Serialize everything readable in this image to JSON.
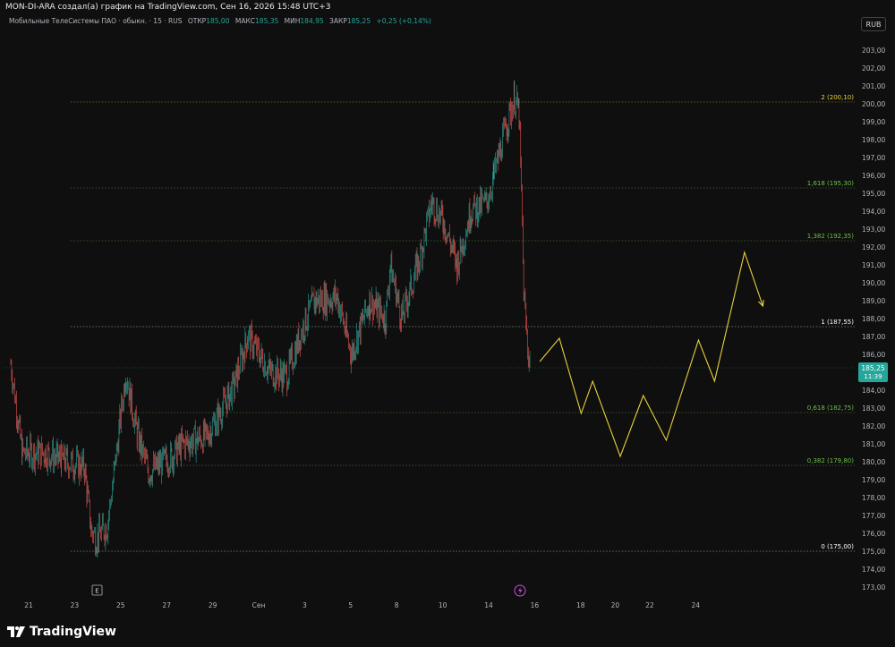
{
  "header": {
    "caption": "MON-DI-ARA создал(а) график на TradingView.com, Сен 16, 2026 15:48 UTC+3"
  },
  "legend": {
    "symbol": "Мобильные ТелеСистемы ПАО · обыкн. · 15 · RUS",
    "open_label": "ОТКР",
    "open": "185,00",
    "high_label": "МАКС",
    "high": "185,35",
    "low_label": "МИН",
    "low": "184,95",
    "close_label": "ЗАКР",
    "close": "185,25",
    "change": "+0,25 (+0,14%)"
  },
  "currency_button": "RUB",
  "event_marker": "E",
  "logo_text": "TradingView",
  "colors": {
    "background": "#0f0f0f",
    "up": "#26a69a",
    "down": "#ef5350",
    "projection": "#e8d13c",
    "fib_green": "#6cc04a",
    "fib_yellow": "#e8d13c",
    "fib_white": "#ffffff"
  },
  "chart_data": {
    "type": "line",
    "y_axis": {
      "ylim": [
        172.6,
        203.8
      ],
      "ticks": [
        "173,00",
        "174,00",
        "175,00",
        "176,00",
        "177,00",
        "178,00",
        "179,00",
        "180,00",
        "181,00",
        "182,00",
        "183,00",
        "184,00",
        "185,00",
        "186,00",
        "187,00",
        "188,00",
        "189,00",
        "190,00",
        "191,00",
        "192,00",
        "193,00",
        "194,00",
        "195,00",
        "196,00",
        "197,00",
        "198,00",
        "199,00",
        "200,00",
        "201,00",
        "202,00",
        "203,00"
      ],
      "tick_values": [
        173,
        174,
        175,
        176,
        177,
        178,
        179,
        180,
        181,
        182,
        183,
        184,
        185,
        186,
        187,
        188,
        189,
        190,
        191,
        192,
        193,
        194,
        195,
        196,
        197,
        198,
        199,
        200,
        201,
        202,
        203
      ]
    },
    "x_axis": {
      "labels": [
        "21",
        "23",
        "25",
        "27",
        "29",
        "Сен",
        "3",
        "5",
        "8",
        "10",
        "14",
        "16",
        "18",
        "20",
        "22",
        "24"
      ],
      "positions": [
        0,
        2,
        4,
        6,
        8,
        10,
        12,
        14,
        16,
        18,
        20,
        22,
        24,
        25.5,
        27,
        29
      ]
    },
    "last_price": {
      "value": 185.25,
      "label": "185,25",
      "time": "11:39"
    },
    "price_path": [
      {
        "x": 0,
        "y": 185.5
      },
      {
        "x": 0.5,
        "y": 180.5
      },
      {
        "x": 1.5,
        "y": 180.5
      },
      {
        "x": 2.2,
        "y": 180.1
      },
      {
        "x": 3.2,
        "y": 179.7
      },
      {
        "x": 3.5,
        "y": 176.2
      },
      {
        "x": 3.7,
        "y": 175.7
      },
      {
        "x": 4.2,
        "y": 176.4
      },
      {
        "x": 4.6,
        "y": 180.5
      },
      {
        "x": 5.0,
        "y": 185.0
      },
      {
        "x": 5.5,
        "y": 181.5
      },
      {
        "x": 6.0,
        "y": 179.4
      },
      {
        "x": 7.0,
        "y": 180.3
      },
      {
        "x": 7.5,
        "y": 181.0
      },
      {
        "x": 8.5,
        "y": 181.4
      },
      {
        "x": 9.0,
        "y": 182.5
      },
      {
        "x": 9.7,
        "y": 184.2
      },
      {
        "x": 10.3,
        "y": 187.0
      },
      {
        "x": 11.3,
        "y": 185.0
      },
      {
        "x": 12.0,
        "y": 184.8
      },
      {
        "x": 12.7,
        "y": 187.5
      },
      {
        "x": 13.2,
        "y": 189.0
      },
      {
        "x": 14.2,
        "y": 189.2
      },
      {
        "x": 14.8,
        "y": 186.0
      },
      {
        "x": 15.6,
        "y": 189.0
      },
      {
        "x": 16.3,
        "y": 188.0
      },
      {
        "x": 16.5,
        "y": 191.0
      },
      {
        "x": 17.0,
        "y": 188.0
      },
      {
        "x": 17.8,
        "y": 191.5
      },
      {
        "x": 18.3,
        "y": 194.5
      },
      {
        "x": 18.8,
        "y": 193.5
      },
      {
        "x": 19.4,
        "y": 191.0
      },
      {
        "x": 20.0,
        "y": 194.0
      },
      {
        "x": 20.7,
        "y": 194.5
      },
      {
        "x": 21.0,
        "y": 196.0
      },
      {
        "x": 21.6,
        "y": 199.0
      },
      {
        "x": 21.9,
        "y": 200.3
      },
      {
        "x": 22.1,
        "y": 199.5
      },
      {
        "x": 22.2,
        "y": 195.0
      },
      {
        "x": 22.3,
        "y": 189.5
      },
      {
        "x": 22.5,
        "y": 186.0
      },
      {
        "x": 22.6,
        "y": 185.25
      }
    ],
    "projection": [
      {
        "x": 23.0,
        "y": 185.6
      },
      {
        "x": 23.85,
        "y": 186.9
      },
      {
        "x": 24.8,
        "y": 182.7
      },
      {
        "x": 25.3,
        "y": 184.5
      },
      {
        "x": 26.5,
        "y": 180.3
      },
      {
        "x": 27.5,
        "y": 183.7
      },
      {
        "x": 28.5,
        "y": 181.2
      },
      {
        "x": 29.9,
        "y": 186.8
      },
      {
        "x": 30.6,
        "y": 184.5
      },
      {
        "x": 31.9,
        "y": 191.7
      },
      {
        "x": 32.7,
        "y": 188.7
      }
    ],
    "fib_levels": [
      {
        "ratio": "0",
        "value": 175.0,
        "label": "0 (175,00)",
        "color": "#ffffff"
      },
      {
        "ratio": "0,382",
        "value": 179.8,
        "label": "0,382 (179,80)",
        "color": "#6cc04a"
      },
      {
        "ratio": "0,618",
        "value": 182.75,
        "label": "0,618 (182,75)",
        "color": "#6cc04a"
      },
      {
        "ratio": "1",
        "value": 187.55,
        "label": "1 (187,55)",
        "color": "#ffffff"
      },
      {
        "ratio": "1,382",
        "value": 192.35,
        "label": "1,382 (192,35)",
        "color": "#6cc04a"
      },
      {
        "ratio": "1,618",
        "value": 195.3,
        "label": "1,618 (195,30)",
        "color": "#6cc04a"
      },
      {
        "ratio": "2",
        "value": 200.1,
        "label": "2 (200,10)",
        "color": "#e8d13c"
      }
    ]
  }
}
